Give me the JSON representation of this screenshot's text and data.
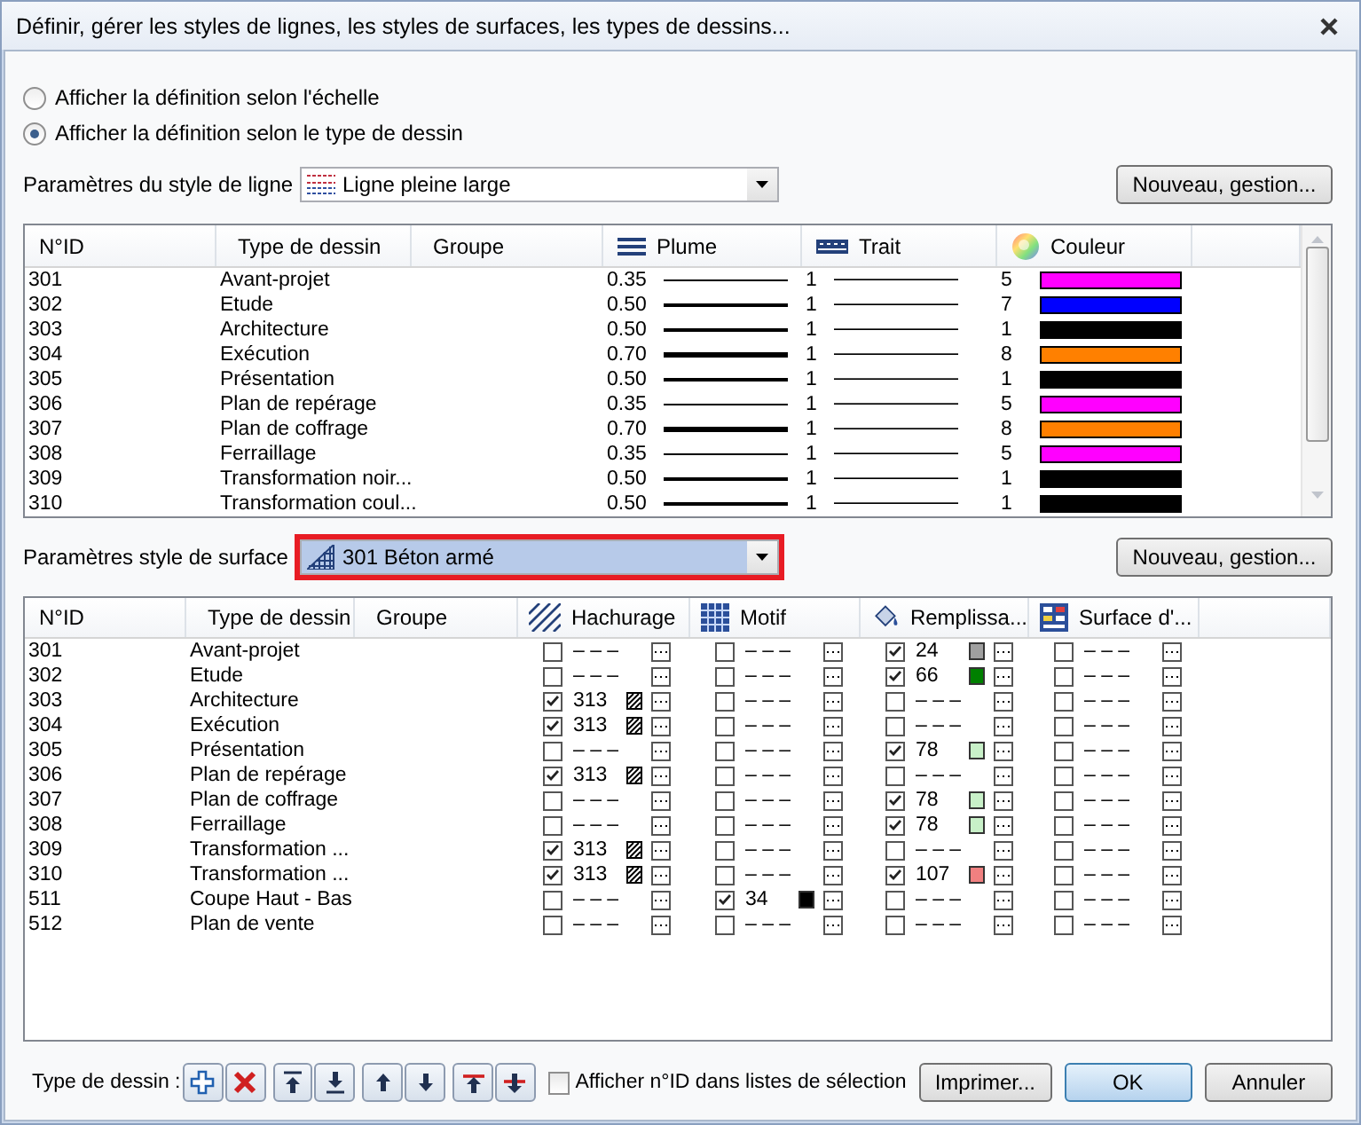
{
  "window": {
    "title": "Définir, gérer les styles de lignes, les styles de surfaces, les types de dessins..."
  },
  "display_options": [
    {
      "label": "Afficher la définition selon l'échelle",
      "selected": false
    },
    {
      "label": "Afficher la définition selon le type de dessin",
      "selected": true
    }
  ],
  "line_style": {
    "label": "Paramètres du style de ligne",
    "value": "Ligne pleine large",
    "button": "Nouveau, gestion..."
  },
  "line_table": {
    "columns": [
      {
        "label": "N°ID",
        "kind": "text"
      },
      {
        "label": "Type de dessin",
        "kind": "text"
      },
      {
        "label": "Groupe",
        "kind": "text"
      },
      {
        "label": "Plume",
        "kind": "pen"
      },
      {
        "label": "Trait",
        "kind": "line"
      },
      {
        "label": "Couleur",
        "kind": "color"
      }
    ],
    "rows": [
      {
        "id": "301",
        "type": "Avant-projet",
        "pen": "0.35",
        "line": "1",
        "color_no": "5",
        "color": "#ff00ff"
      },
      {
        "id": "302",
        "type": "Etude",
        "pen": "0.50",
        "line": "1",
        "color_no": "7",
        "color": "#0000ff"
      },
      {
        "id": "303",
        "type": "Architecture",
        "pen": "0.50",
        "line": "1",
        "color_no": "1",
        "color": "#000000"
      },
      {
        "id": "304",
        "type": "Exécution",
        "pen": "0.70",
        "line": "1",
        "color_no": "8",
        "color": "#ff8000"
      },
      {
        "id": "305",
        "type": "Présentation",
        "pen": "0.50",
        "line": "1",
        "color_no": "1",
        "color": "#000000"
      },
      {
        "id": "306",
        "type": "Plan de repérage",
        "pen": "0.35",
        "line": "1",
        "color_no": "5",
        "color": "#ff00ff"
      },
      {
        "id": "307",
        "type": "Plan de coffrage",
        "pen": "0.70",
        "line": "1",
        "color_no": "8",
        "color": "#ff8000"
      },
      {
        "id": "308",
        "type": "Ferraillage",
        "pen": "0.35",
        "line": "1",
        "color_no": "5",
        "color": "#ff00ff"
      },
      {
        "id": "309",
        "type": "Transformation noir...",
        "pen": "0.50",
        "line": "1",
        "color_no": "1",
        "color": "#000000"
      },
      {
        "id": "310",
        "type": "Transformation coul...",
        "pen": "0.50",
        "line": "1",
        "color_no": "1",
        "color": "#000000"
      }
    ]
  },
  "surface_style": {
    "label": "Paramètres style de surface",
    "value": "301 Béton armé",
    "highlighted": true,
    "button": "Nouveau, gestion..."
  },
  "surface_table": {
    "columns": [
      {
        "label": "N°ID",
        "kind": "id"
      },
      {
        "label": "Type de dessin",
        "kind": "type"
      },
      {
        "label": "Groupe",
        "kind": "group"
      },
      {
        "label": "Hachurage",
        "kind": "hatch"
      },
      {
        "label": "Motif",
        "kind": "pattern"
      },
      {
        "label": "Remplissa...",
        "kind": "fill"
      },
      {
        "label": "Surface d'...",
        "kind": "surface"
      }
    ],
    "rows": [
      {
        "id": "301",
        "type": "Avant-projet",
        "hatch": {
          "kind": "empty",
          "checked": false,
          "value": "– – –"
        },
        "pattern": {
          "kind": "empty",
          "checked": false,
          "value": "– – –"
        },
        "fill": {
          "kind": "color",
          "checked": true,
          "value": "24",
          "color": "#a0a0a0"
        },
        "surface": {
          "kind": "empty",
          "checked": false,
          "value": "– – –"
        }
      },
      {
        "id": "302",
        "type": "Etude",
        "hatch": {
          "kind": "empty",
          "checked": false,
          "value": "– – –"
        },
        "pattern": {
          "kind": "empty",
          "checked": false,
          "value": "– – –"
        },
        "fill": {
          "kind": "color",
          "checked": true,
          "value": "66",
          "color": "#008000"
        },
        "surface": {
          "kind": "empty",
          "checked": false,
          "value": "– – –"
        }
      },
      {
        "id": "303",
        "type": "Architecture",
        "hatch": {
          "kind": "hatch",
          "checked": true,
          "value": "313"
        },
        "pattern": {
          "kind": "empty",
          "checked": false,
          "value": "– – –"
        },
        "fill": {
          "kind": "empty",
          "checked": false,
          "value": "– – –"
        },
        "surface": {
          "kind": "empty",
          "checked": false,
          "value": "– – –"
        }
      },
      {
        "id": "304",
        "type": "Exécution",
        "hatch": {
          "kind": "hatch",
          "checked": true,
          "value": "313"
        },
        "pattern": {
          "kind": "empty",
          "checked": false,
          "value": "– – –"
        },
        "fill": {
          "kind": "empty",
          "checked": false,
          "value": "– – –"
        },
        "surface": {
          "kind": "empty",
          "checked": false,
          "value": "– – –"
        }
      },
      {
        "id": "305",
        "type": "Présentation",
        "hatch": {
          "kind": "empty",
          "checked": false,
          "value": "– – –"
        },
        "pattern": {
          "kind": "empty",
          "checked": false,
          "value": "– – –"
        },
        "fill": {
          "kind": "color",
          "checked": true,
          "value": "78",
          "color": "#c8f0c8"
        },
        "surface": {
          "kind": "empty",
          "checked": false,
          "value": "– – –"
        }
      },
      {
        "id": "306",
        "type": "Plan de repérage",
        "hatch": {
          "kind": "hatch",
          "checked": true,
          "value": "313"
        },
        "pattern": {
          "kind": "empty",
          "checked": false,
          "value": "– – –"
        },
        "fill": {
          "kind": "empty",
          "checked": false,
          "value": "– – –"
        },
        "surface": {
          "kind": "empty",
          "checked": false,
          "value": "– – –"
        }
      },
      {
        "id": "307",
        "type": "Plan de coffrage",
        "hatch": {
          "kind": "empty",
          "checked": false,
          "value": "– – –"
        },
        "pattern": {
          "kind": "empty",
          "checked": false,
          "value": "– – –"
        },
        "fill": {
          "kind": "color",
          "checked": true,
          "value": "78",
          "color": "#c8f0c8"
        },
        "surface": {
          "kind": "empty",
          "checked": false,
          "value": "– – –"
        }
      },
      {
        "id": "308",
        "type": "Ferraillage",
        "hatch": {
          "kind": "empty",
          "checked": false,
          "value": "– – –"
        },
        "pattern": {
          "kind": "empty",
          "checked": false,
          "value": "– – –"
        },
        "fill": {
          "kind": "color",
          "checked": true,
          "value": "78",
          "color": "#c8f0c8"
        },
        "surface": {
          "kind": "empty",
          "checked": false,
          "value": "– – –"
        }
      },
      {
        "id": "309",
        "type": "Transformation ...",
        "hatch": {
          "kind": "hatch",
          "checked": true,
          "value": "313"
        },
        "pattern": {
          "kind": "empty",
          "checked": false,
          "value": "– – –"
        },
        "fill": {
          "kind": "empty",
          "checked": false,
          "value": "– – –"
        },
        "surface": {
          "kind": "empty",
          "checked": false,
          "value": "– – –"
        }
      },
      {
        "id": "310",
        "type": "Transformation ...",
        "hatch": {
          "kind": "hatch",
          "checked": true,
          "value": "313"
        },
        "pattern": {
          "kind": "empty",
          "checked": false,
          "value": "– – –"
        },
        "fill": {
          "kind": "color",
          "checked": true,
          "value": "107",
          "color": "#f08080"
        },
        "surface": {
          "kind": "empty",
          "checked": false,
          "value": "– – –"
        }
      },
      {
        "id": "511",
        "type": "Coupe Haut - Bas",
        "hatch": {
          "kind": "empty",
          "checked": false,
          "value": "– – –"
        },
        "pattern": {
          "kind": "color",
          "checked": true,
          "value": "34",
          "color": "#000000"
        },
        "fill": {
          "kind": "empty",
          "checked": false,
          "value": "– – –"
        },
        "surface": {
          "kind": "empty",
          "checked": false,
          "value": "– – –"
        }
      },
      {
        "id": "512",
        "type": "Plan de vente",
        "hatch": {
          "kind": "empty",
          "checked": false,
          "value": "– – –"
        },
        "pattern": {
          "kind": "empty",
          "checked": false,
          "value": "– – –"
        },
        "fill": {
          "kind": "empty",
          "checked": false,
          "value": "– – –"
        },
        "surface": {
          "kind": "empty",
          "checked": false,
          "value": "– – –"
        }
      }
    ]
  },
  "footer": {
    "label": "Type de dessin :",
    "show_ids": {
      "label": "Afficher n°ID dans listes de sélection",
      "checked": false
    },
    "buttons": [
      {
        "label": "Imprimer...",
        "default": false
      },
      {
        "label": "OK",
        "default": true
      },
      {
        "label": "Annuler",
        "default": false
      }
    ]
  }
}
